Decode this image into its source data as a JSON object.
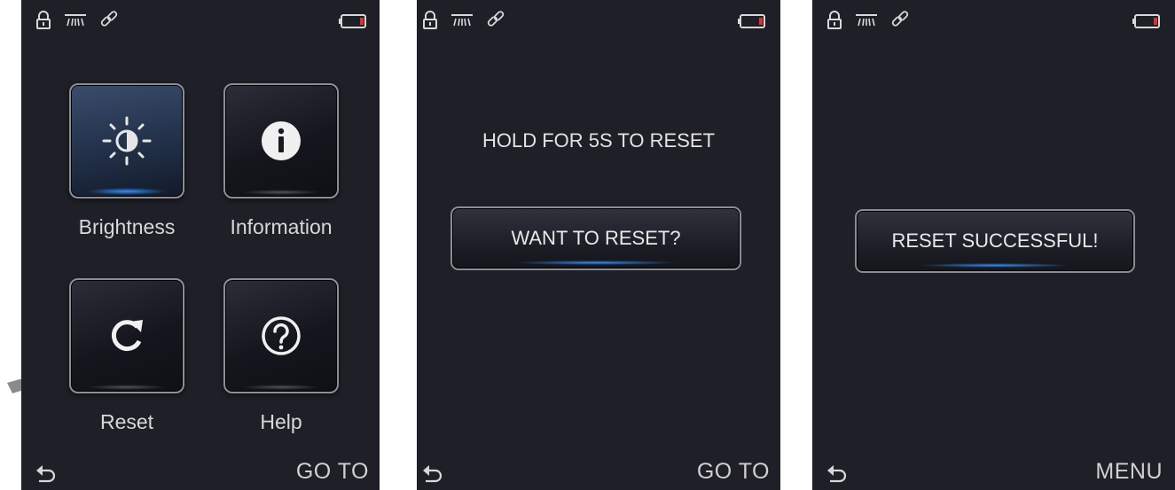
{
  "screens": [
    {
      "status_icons": [
        "lock-icon",
        "light-icon",
        "link-icon",
        "battery-icon"
      ],
      "tiles": [
        {
          "label": "Brightness",
          "icon": "brightness-icon",
          "active": true
        },
        {
          "label": "Information",
          "icon": "info-icon",
          "active": false
        },
        {
          "label": "Reset",
          "icon": "reset-icon",
          "active": false
        },
        {
          "label": "Help",
          "icon": "help-icon",
          "active": false
        }
      ],
      "bottom_label": "GO TO"
    },
    {
      "prompt": "HOLD FOR 5S TO RESET",
      "button_label": "WANT TO RESET?",
      "bottom_label": "GO TO"
    },
    {
      "button_label": "RESET SUCCESSFUL!",
      "bottom_label": "MENU"
    }
  ],
  "colors": {
    "screen_bg": "#1e1f27",
    "accent_blue": "#2f8fff",
    "battery_red": "#e03030",
    "pointer_arrow": "#8a8a8a"
  }
}
